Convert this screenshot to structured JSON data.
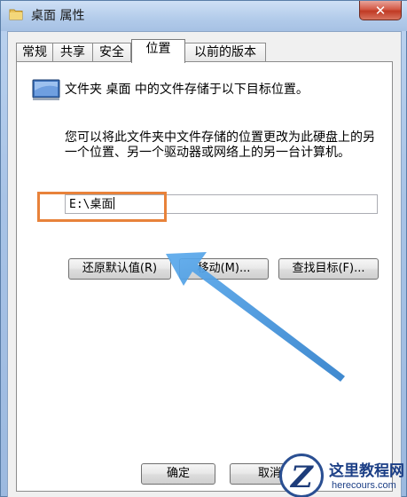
{
  "window": {
    "title": "桌面 属性",
    "close_glyph": "✕"
  },
  "tabs": [
    {
      "label": "常规",
      "active": false
    },
    {
      "label": "共享",
      "active": false
    },
    {
      "label": "安全",
      "active": false
    },
    {
      "label": "位置",
      "active": true
    },
    {
      "label": "以前的版本",
      "active": false
    }
  ],
  "location": {
    "intro": "文件夹 桌面 中的文件存储于以下目标位置。",
    "description": "您可以将此文件夹中文件存储的位置更改为此硬盘上的另一个位置、另一个驱动器或网络上的另一台计算机。",
    "path_value": "E:\\桌面",
    "restore_default_label": "还原默认值(R)",
    "move_label": "移动(M)...",
    "find_target_label": "查找目标(F)..."
  },
  "footer": {
    "ok_label": "确定",
    "cancel_label": "取消"
  },
  "watermark": {
    "title": "这里教程网",
    "url": "herecours.com"
  },
  "colors": {
    "highlight_box": "#e8823a",
    "arrow": "#3d8fd6"
  }
}
